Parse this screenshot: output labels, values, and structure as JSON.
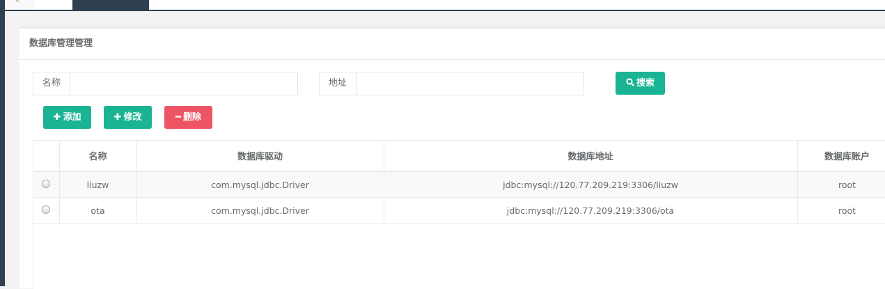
{
  "panel": {
    "title": "数据库管理管理"
  },
  "filters": {
    "name_label": "名称",
    "name_value": "",
    "address_label": "地址",
    "address_value": ""
  },
  "buttons": {
    "search": "搜索",
    "add": "添加",
    "edit": "修改",
    "delete": "删除"
  },
  "table": {
    "columns": [
      "",
      "名称",
      "数据库驱动",
      "数据库地址",
      "数据库账户"
    ],
    "rows": [
      {
        "name": "liuzw",
        "driver": "com.mysql.jdbc.Driver",
        "url": "jdbc:mysql://120.77.209.219:3306/liuzw",
        "account": "root"
      },
      {
        "name": "ota",
        "driver": "com.mysql.jdbc.Driver",
        "url": "jdbc:mysql://120.77.209.219:3306/ota",
        "account": "root"
      }
    ]
  },
  "colors": {
    "primary": "#1ab394",
    "danger": "#ed5565",
    "nav_dark": "#2f4050"
  }
}
